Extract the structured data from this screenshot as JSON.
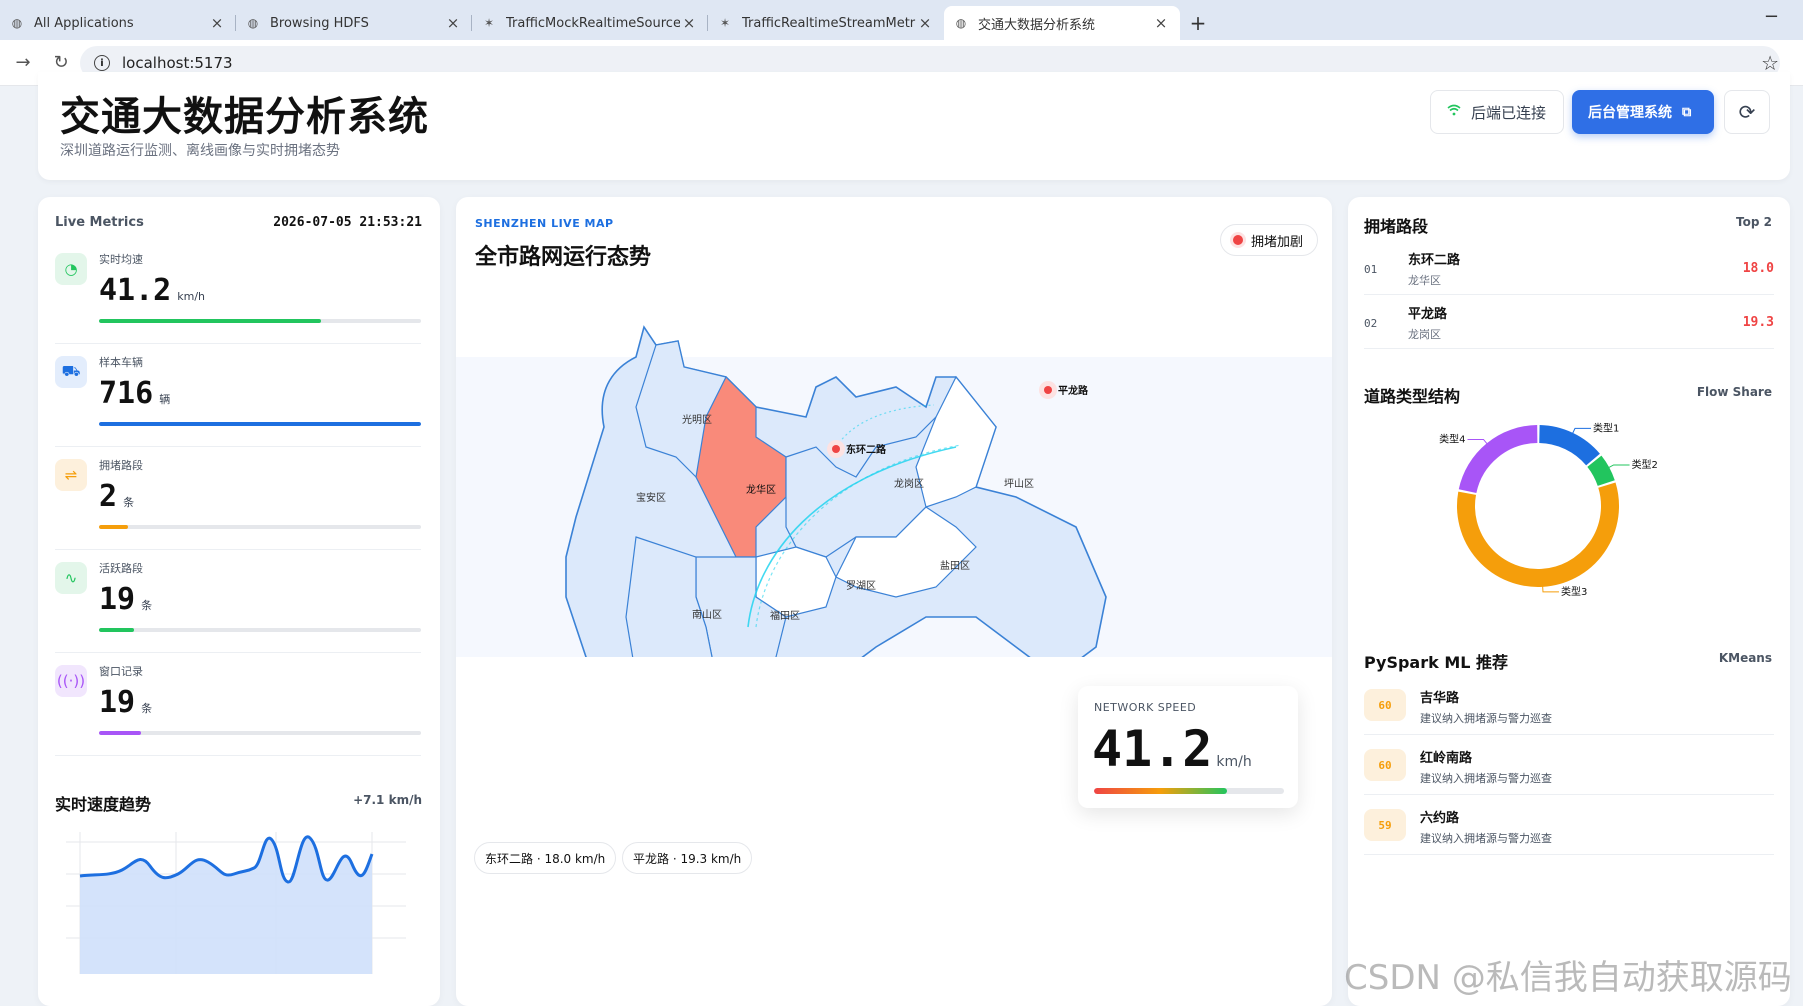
{
  "browser": {
    "tabs": [
      {
        "label": "All Applications",
        "icon": "globe-icon",
        "active": false
      },
      {
        "label": "Browsing HDFS",
        "icon": "globe-icon",
        "active": false
      },
      {
        "label": "TrafficMockRealtimeSource -",
        "icon": "flink-icon",
        "active": false
      },
      {
        "label": "TrafficRealtimeStreamMetrics",
        "icon": "flink-icon",
        "active": false
      },
      {
        "label": "交通大数据分析系统",
        "icon": "globe-icon",
        "active": true
      }
    ],
    "new_tab": "+",
    "minimize": "−",
    "url": "localhost:5173"
  },
  "header": {
    "title": "交通大数据分析系统",
    "subtitle": "深圳道路运行监测、离线画像与实时拥堵态势",
    "connection_label": "后端已连接",
    "admin_label": "后台管理系统",
    "refresh_icon": "refresh-icon"
  },
  "live_metrics": {
    "heading": "Live Metrics",
    "timestamp": "2026-07-05 21:53:21",
    "items": [
      {
        "label": "实时均速",
        "value": "41.2",
        "unit": "km/h",
        "icon": "gauge-icon",
        "color": "#22c55e",
        "icon_bg": "#e3f6ea",
        "progress": 0.69
      },
      {
        "label": "样本车辆",
        "value": "716",
        "unit": "辆",
        "icon": "car-icon",
        "color": "#1d6fe0",
        "icon_bg": "#e3edfc",
        "progress": 1.0
      },
      {
        "label": "拥堵路段",
        "value": "2",
        "unit": "条",
        "icon": "route-icon",
        "color": "#f59e0b",
        "icon_bg": "#fdf0dc",
        "progress": 0.09
      },
      {
        "label": "活跃路段",
        "value": "19",
        "unit": "条",
        "icon": "activity-icon",
        "color": "#22c55e",
        "icon_bg": "#e3f6ea",
        "progress": 0.11
      },
      {
        "label": "窗口记录",
        "value": "19",
        "unit": "条",
        "icon": "broadcast-icon",
        "color": "#a855f7",
        "icon_bg": "#f1e6fd",
        "progress": 0.13
      }
    ]
  },
  "speed_trend": {
    "title": "实时速度趋势",
    "delta": "+7.1 km/h"
  },
  "map": {
    "kicker": "SHENZHEN LIVE MAP",
    "title": "全市路网运行态势",
    "alert_label": "拥堵加剧",
    "districts": [
      "光明区",
      "宝安区",
      "龙华区",
      "龙岗区",
      "坪山区",
      "南山区",
      "福田区",
      "罗湖区",
      "盐田区"
    ],
    "markers": [
      "东环二路",
      "平龙路"
    ],
    "network_speed_label": "NETWORK SPEED",
    "network_speed_value": "41.2",
    "network_speed_unit": "km/h",
    "network_speed_progress": 0.7,
    "road_chips": [
      "东环二路 · 18.0 km/h",
      "平龙路 · 19.3 km/h"
    ],
    "colors": {
      "highlight": "#f98a7a",
      "land": "#dce9fb",
      "outline": "#3b82d6",
      "flow": "#22d3ee"
    }
  },
  "congestion": {
    "title": "拥堵路段",
    "tag": "Top 2",
    "rows": [
      {
        "rank": "01",
        "name": "东环二路",
        "district": "龙华区",
        "speed": "18.0"
      },
      {
        "rank": "02",
        "name": "平龙路",
        "district": "龙岗区",
        "speed": "19.3"
      }
    ]
  },
  "road_types": {
    "title": "道路类型结构",
    "tag": "Flow Share"
  },
  "chart_data": {
    "type": "pie",
    "title": "道路类型结构",
    "categories": [
      "类型1",
      "类型2",
      "类型3",
      "类型4"
    ],
    "values": [
      14,
      6,
      58,
      22
    ],
    "colors": [
      "#1d6fe0",
      "#22c55e",
      "#f59e0b",
      "#a855f7"
    ],
    "donut": true
  },
  "ml": {
    "title": "PySpark ML 推荐",
    "tag": "KMeans",
    "rows": [
      {
        "score": "60",
        "name": "吉华路",
        "note": "建议纳入拥堵源与警力巡查"
      },
      {
        "score": "60",
        "name": "红岭南路",
        "note": "建议纳入拥堵源与警力巡查"
      },
      {
        "score": "59",
        "name": "六约路",
        "note": "建议纳入拥堵源与警力巡查"
      }
    ]
  },
  "watermark": "CSDN @私信我自动获取源码"
}
